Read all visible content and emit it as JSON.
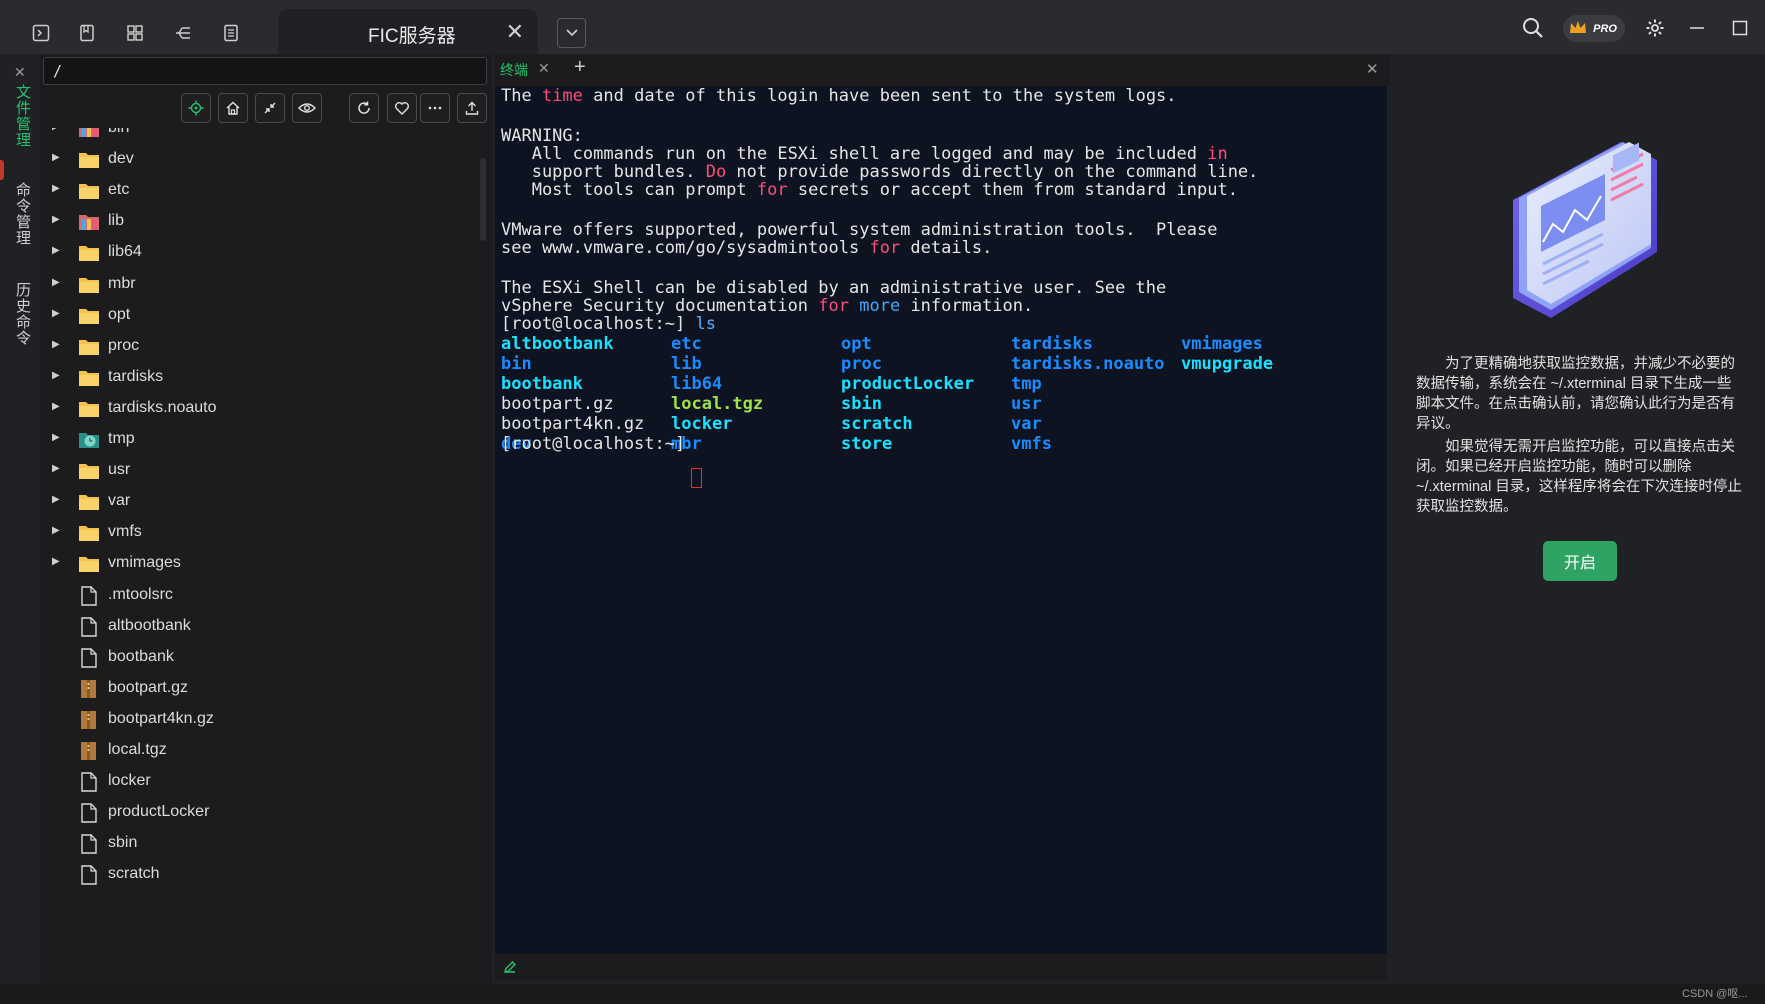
{
  "titlebar": {
    "tab_title": "FIC服务器",
    "tab_close": "✕",
    "dropdown": "⌄",
    "pro_badge": "PRO",
    "left_icons": [
      "terminal-icon",
      "bookmark-icon",
      "layout-icon",
      "branch-icon",
      "list-icon"
    ],
    "right_icons": [
      "search-icon",
      "crown-icon",
      "gear-icon",
      "minimize-icon",
      "maximize-icon"
    ]
  },
  "rail": {
    "close": "✕",
    "tabs": [
      "文件管理",
      "命令管理",
      "历史命令"
    ],
    "active_color": "#27c26b"
  },
  "file_manager": {
    "path": "/",
    "toolbar_icons": [
      "locate-icon",
      "home-icon",
      "collapse-icon",
      "eye-icon",
      "refresh-icon",
      "heart-icon",
      "more-icon",
      "upload-icon"
    ],
    "items": [
      {
        "name": "bin",
        "type": "folder-special"
      },
      {
        "name": "dev",
        "type": "folder"
      },
      {
        "name": "etc",
        "type": "folder"
      },
      {
        "name": "lib",
        "type": "folder-special"
      },
      {
        "name": "lib64",
        "type": "folder"
      },
      {
        "name": "mbr",
        "type": "folder"
      },
      {
        "name": "opt",
        "type": "folder"
      },
      {
        "name": "proc",
        "type": "folder"
      },
      {
        "name": "tardisks",
        "type": "folder"
      },
      {
        "name": "tardisks.noauto",
        "type": "folder"
      },
      {
        "name": "tmp",
        "type": "folder-clock"
      },
      {
        "name": "usr",
        "type": "folder"
      },
      {
        "name": "var",
        "type": "folder"
      },
      {
        "name": "vmfs",
        "type": "folder"
      },
      {
        "name": "vmimages",
        "type": "folder"
      },
      {
        "name": ".mtoolsrc",
        "type": "file"
      },
      {
        "name": "altbootbank",
        "type": "file"
      },
      {
        "name": "bootbank",
        "type": "file"
      },
      {
        "name": "bootpart.gz",
        "type": "archive"
      },
      {
        "name": "bootpart4kn.gz",
        "type": "archive"
      },
      {
        "name": "local.tgz",
        "type": "archive"
      },
      {
        "name": "locker",
        "type": "file"
      },
      {
        "name": "productLocker",
        "type": "file"
      },
      {
        "name": "sbin",
        "type": "file"
      },
      {
        "name": "scratch",
        "type": "file"
      }
    ]
  },
  "terminal": {
    "tab_label": "终端",
    "tab_close": "✕",
    "add_tab": "+",
    "close": "✕",
    "prompt": "[root@localhost:~]",
    "command": "ls",
    "ls_columns": [
      [
        {
          "text": "altbootbank",
          "color": "cyan"
        },
        {
          "text": "bin",
          "color": "blue"
        },
        {
          "text": "bootbank",
          "color": "cyan"
        },
        {
          "text": "bootpart.gz",
          "color": "white"
        },
        {
          "text": "bootpart4kn.gz",
          "color": "white"
        },
        {
          "text": "dev",
          "color": "blue"
        }
      ],
      [
        {
          "text": "etc",
          "color": "blue"
        },
        {
          "text": "lib",
          "color": "blue"
        },
        {
          "text": "lib64",
          "color": "blue"
        },
        {
          "text": "local.tgz",
          "color": "green"
        },
        {
          "text": "locker",
          "color": "cyan"
        },
        {
          "text": "mbr",
          "color": "blue"
        }
      ],
      [
        {
          "text": "opt",
          "color": "blue"
        },
        {
          "text": "proc",
          "color": "blue"
        },
        {
          "text": "productLocker",
          "color": "cyan"
        },
        {
          "text": "sbin",
          "color": "cyan"
        },
        {
          "text": "scratch",
          "color": "cyan"
        },
        {
          "text": "store",
          "color": "cyan"
        }
      ],
      [
        {
          "text": "tardisks",
          "color": "blue"
        },
        {
          "text": "tardisks.noauto",
          "color": "blue"
        },
        {
          "text": "tmp",
          "color": "blue"
        },
        {
          "text": "usr",
          "color": "blue"
        },
        {
          "text": "var",
          "color": "blue"
        },
        {
          "text": "vmfs",
          "color": "blue"
        }
      ],
      [
        {
          "text": "vmimages",
          "color": "blue"
        },
        {
          "text": "vmupgrade",
          "color": "cyan"
        }
      ]
    ]
  },
  "monitor_panel": {
    "paragraph1": "为了更精确地获取监控数据，并减少不必要的数据传输，系统会在 ~/.xterminal 目录下生成一些脚本文件。在点击确认前，请您确认此行为是否有异议。",
    "paragraph2": "如果觉得无需开启监控功能，可以直接点击关闭。如果已经开启监控功能，随时可以删除 ~/.xterminal 目录，这样程序将会在下次连接时停止获取监控数据。",
    "button": "开启"
  },
  "watermark": "CSDN @呕..."
}
